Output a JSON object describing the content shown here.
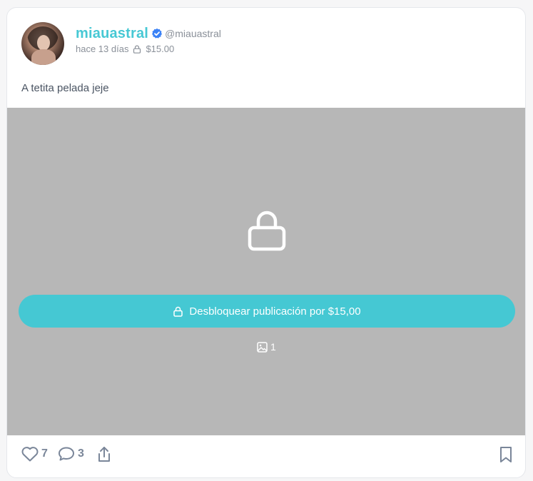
{
  "post": {
    "author": {
      "name": "miauastral",
      "handle": "@miauastral",
      "verified": true
    },
    "time": "hace 13 días",
    "price": "$15.00",
    "caption": "A tetita pelada jeje",
    "unlock_label": "Desbloquear publicación por $15,00",
    "media_count": "1",
    "likes": "7",
    "comments": "3"
  },
  "colors": {
    "accent": "#45c8d3",
    "name": "#47c8d4",
    "verified": "#3b82f6",
    "media_bg": "#b7b7b7",
    "muted": "#8a9099",
    "action": "#7a8699"
  },
  "icons": {
    "verified": "verified-badge-icon",
    "price_lock": "lock-icon",
    "media_lock": "lock-icon",
    "unlock": "unlock-icon",
    "image": "image-icon",
    "like": "heart-icon",
    "comment": "comment-icon",
    "share": "share-icon",
    "bookmark": "bookmark-icon"
  }
}
